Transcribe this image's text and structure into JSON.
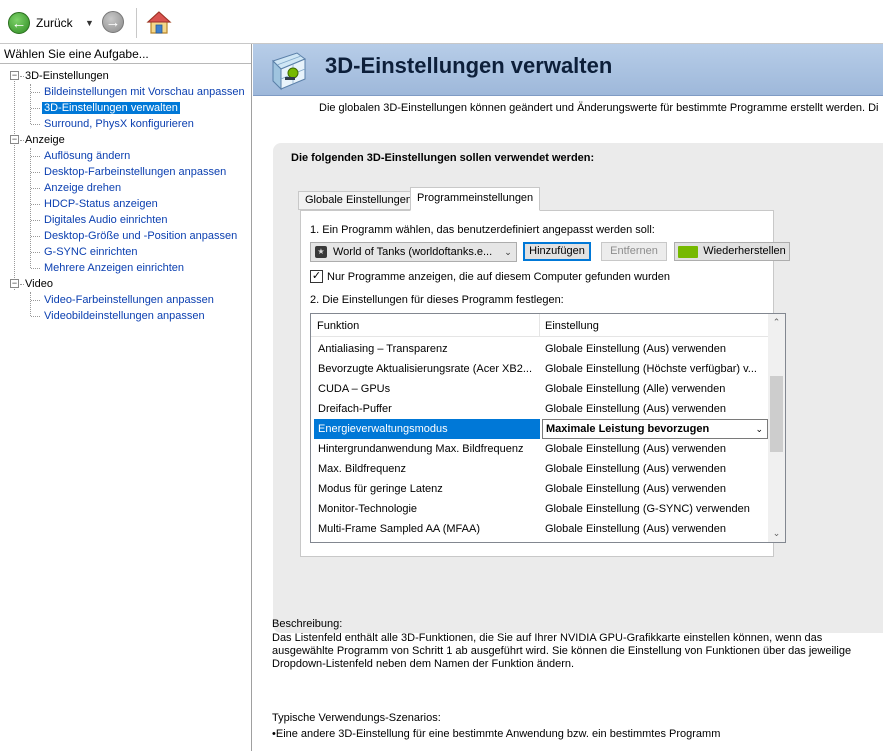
{
  "toolbar": {
    "back_label": "Zurück"
  },
  "left": {
    "header": "Wählen Sie eine Aufgabe...",
    "categories": [
      {
        "label": "3D-Einstellungen",
        "expander": "−",
        "items": [
          "Bildeinstellungen mit Vorschau anpassen",
          "3D-Einstellungen verwalten",
          "Surround, PhysX konfigurieren"
        ]
      },
      {
        "label": "Anzeige",
        "expander": "−",
        "items": [
          "Auflösung ändern",
          "Desktop-Farbeinstellungen anpassen",
          "Anzeige drehen",
          "HDCP-Status anzeigen",
          "Digitales Audio einrichten",
          "Desktop-Größe und -Position anpassen",
          "G-SYNC einrichten",
          "Mehrere Anzeigen einrichten"
        ]
      },
      {
        "label": "Video",
        "expander": "−",
        "items": [
          "Video-Farbeinstellungen anpassen",
          "Videobildeinstellungen anpassen"
        ]
      }
    ]
  },
  "main": {
    "title": "3D-Einstellungen verwalten",
    "intro": "Die globalen 3D-Einstellungen können geändert und Änderungswerte für bestimmte Programme erstellt werden. Di",
    "heading": "Die folgenden 3D-Einstellungen sollen verwendet werden:",
    "tabs": {
      "global": "Globale Einstellungen",
      "program": "Programmeinstellungen"
    },
    "step1": "1. Ein Programm wählen, das benutzerdefiniert angepasst werden soll:",
    "program_select": "World of Tanks (worldoftanks.e...",
    "buttons": {
      "add": "Hinzufügen",
      "remove": "Entfernen",
      "restore": "Wiederherstellen"
    },
    "checkbox_label": "Nur Programme anzeigen, die auf diesem Computer gefunden wurden",
    "checkbox_mark": "✓",
    "step2": "2. Die Einstellungen für dieses Programm festlegen:",
    "table": {
      "headers": [
        "Funktion",
        "Einstellung"
      ],
      "rows": [
        {
          "f": "Antialiasing – Transparenz",
          "s": "Globale Einstellung (Aus) verwenden"
        },
        {
          "f": "Bevorzugte Aktualisierungsrate (Acer XB2...",
          "s": "Globale Einstellung (Höchste verfügbar) v..."
        },
        {
          "f": "CUDA – GPUs",
          "s": "Globale Einstellung (Alle) verwenden"
        },
        {
          "f": "Dreifach-Puffer",
          "s": "Globale Einstellung (Aus) verwenden"
        },
        {
          "f": "Energieverwaltungsmodus",
          "s": "Maximale Leistung bevorzugen"
        },
        {
          "f": "Hintergrundanwendung Max. Bildfrequenz",
          "s": "Globale Einstellung (Aus) verwenden"
        },
        {
          "f": "Max. Bildfrequenz",
          "s": "Globale Einstellung (Aus) verwenden"
        },
        {
          "f": "Modus für geringe Latenz",
          "s": "Globale Einstellung (Aus) verwenden"
        },
        {
          "f": "Monitor-Technologie",
          "s": "Globale Einstellung (G-SYNC) verwenden"
        },
        {
          "f": "Multi-Frame Sampled AA (MFAA)",
          "s": "Globale Einstellung (Aus) verwenden"
        }
      ]
    },
    "description_label": "Beschreibung:",
    "description": "Das Listenfeld enthält alle 3D-Funktionen, die Sie auf Ihrer NVIDIA GPU-Grafikkarte einstellen können, wenn das ausgewählte Programm von Schritt 1 ab ausgeführt wird. Sie können die Einstellung von Funktionen über das jeweilige Dropdown-Listenfeld neben dem Namen der Funktion ändern.",
    "usage_label": "Typische Verwendungs-Szenarios:",
    "usage_item": "Eine andere 3D-Einstellung für eine bestimmte Anwendung bzw. ein bestimmtes Programm"
  }
}
